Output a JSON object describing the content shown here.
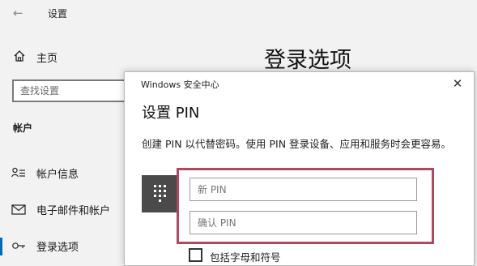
{
  "settings": {
    "title": "设置",
    "home_label": "主页",
    "search_placeholder": "查找设置",
    "section_label": "帐户",
    "nav": {
      "account_info": "帐户信息",
      "email_accounts": "电子邮件和帐户",
      "sign_in_options": "登录选项"
    },
    "page_title": "登录选项"
  },
  "dialog": {
    "caption": "Windows 安全中心",
    "close": "✕",
    "title": "设置 PIN",
    "description": "创建 PIN 以代替密码。使用 PIN 登录设备、应用和服务时会更容易。",
    "new_pin_placeholder": "新 PIN",
    "confirm_pin_placeholder": "确认 PIN",
    "checkbox_label": "包括字母和符号",
    "highlight_color": "#b0485f"
  }
}
